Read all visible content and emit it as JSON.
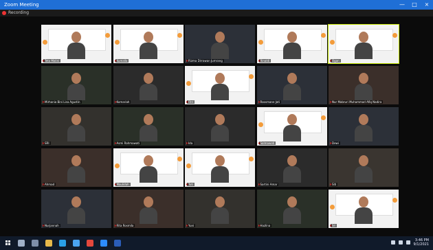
{
  "window": {
    "title": "Zoom Meeting"
  },
  "subbar": {
    "label": "Recording"
  },
  "controls": {
    "minimize": "—",
    "maximize": "□",
    "close": "×"
  },
  "tiles": [
    {
      "name": "Teto Malini",
      "kind": "slide",
      "speaker": false
    },
    {
      "name": "Kumalla",
      "kind": "slide",
      "speaker": false
    },
    {
      "name": "Rizma Dirrawan Jumrang",
      "kind": "camera",
      "speaker": false
    },
    {
      "name": "Rinaldi",
      "kind": "slide",
      "speaker": false
    },
    {
      "name": "Ogan",
      "kind": "slide",
      "speaker": true
    },
    {
      "name": "Mirhania Bini Lisa Agustin",
      "kind": "camera",
      "speaker": false
    },
    {
      "name": "Komariah",
      "kind": "camera",
      "speaker": false
    },
    {
      "name": "Fitri",
      "kind": "slide",
      "speaker": false
    },
    {
      "name": "Roosmane Jati",
      "kind": "camera",
      "speaker": false
    },
    {
      "name": "Nur Mabruri Muhammad Afiq Nadira",
      "kind": "camera",
      "speaker": false
    },
    {
      "name": "SRI",
      "kind": "camera",
      "speaker": false
    },
    {
      "name": "Asmi Rahmawati",
      "kind": "camera",
      "speaker": false
    },
    {
      "name": "Ida",
      "kind": "camera",
      "speaker": false
    },
    {
      "name": "Salmawati",
      "kind": "slide",
      "speaker": false
    },
    {
      "name": "Dewi",
      "kind": "camera",
      "speaker": false
    },
    {
      "name": "Ahmad",
      "kind": "camera",
      "speaker": false
    },
    {
      "name": "Maulidah",
      "kind": "slide",
      "speaker": false
    },
    {
      "name": "Tuti",
      "kind": "slide",
      "speaker": false
    },
    {
      "name": "Sartini Amar",
      "kind": "camera",
      "speaker": false
    },
    {
      "name": "Siti",
      "kind": "camera",
      "speaker": false
    },
    {
      "name": "Nurjannah",
      "kind": "camera",
      "speaker": false
    },
    {
      "name": "Rita Rosmila",
      "kind": "camera",
      "speaker": false
    },
    {
      "name": "Yuni",
      "kind": "camera",
      "speaker": false
    },
    {
      "name": "Hazlina",
      "kind": "camera",
      "speaker": false
    },
    {
      "name": "Sri",
      "kind": "slide",
      "speaker": false
    }
  ],
  "taskbar": {
    "time": "3:46 PM",
    "date": "9/1/2021"
  },
  "colors": {
    "titlebar": "#1f6fd6",
    "speaker_outline": "#c7e600",
    "accent_dot": "#f39c3b"
  }
}
